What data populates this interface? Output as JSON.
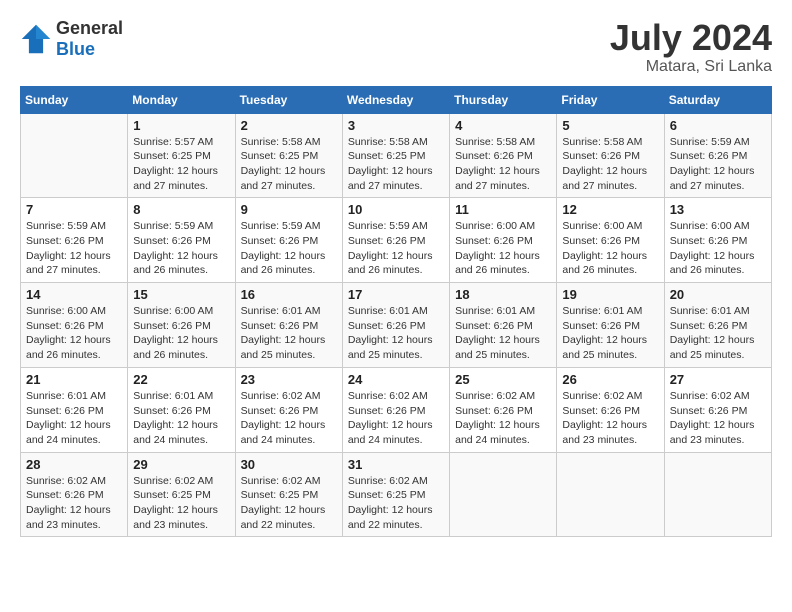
{
  "logo": {
    "general": "General",
    "blue": "Blue"
  },
  "header": {
    "month": "July 2024",
    "location": "Matara, Sri Lanka"
  },
  "days_of_week": [
    "Sunday",
    "Monday",
    "Tuesday",
    "Wednesday",
    "Thursday",
    "Friday",
    "Saturday"
  ],
  "weeks": [
    [
      {
        "day": "",
        "info": ""
      },
      {
        "day": "1",
        "info": "Sunrise: 5:57 AM\nSunset: 6:25 PM\nDaylight: 12 hours\nand 27 minutes."
      },
      {
        "day": "2",
        "info": "Sunrise: 5:58 AM\nSunset: 6:25 PM\nDaylight: 12 hours\nand 27 minutes."
      },
      {
        "day": "3",
        "info": "Sunrise: 5:58 AM\nSunset: 6:25 PM\nDaylight: 12 hours\nand 27 minutes."
      },
      {
        "day": "4",
        "info": "Sunrise: 5:58 AM\nSunset: 6:26 PM\nDaylight: 12 hours\nand 27 minutes."
      },
      {
        "day": "5",
        "info": "Sunrise: 5:58 AM\nSunset: 6:26 PM\nDaylight: 12 hours\nand 27 minutes."
      },
      {
        "day": "6",
        "info": "Sunrise: 5:59 AM\nSunset: 6:26 PM\nDaylight: 12 hours\nand 27 minutes."
      }
    ],
    [
      {
        "day": "7",
        "info": "Sunrise: 5:59 AM\nSunset: 6:26 PM\nDaylight: 12 hours\nand 27 minutes."
      },
      {
        "day": "8",
        "info": "Sunrise: 5:59 AM\nSunset: 6:26 PM\nDaylight: 12 hours\nand 26 minutes."
      },
      {
        "day": "9",
        "info": "Sunrise: 5:59 AM\nSunset: 6:26 PM\nDaylight: 12 hours\nand 26 minutes."
      },
      {
        "day": "10",
        "info": "Sunrise: 5:59 AM\nSunset: 6:26 PM\nDaylight: 12 hours\nand 26 minutes."
      },
      {
        "day": "11",
        "info": "Sunrise: 6:00 AM\nSunset: 6:26 PM\nDaylight: 12 hours\nand 26 minutes."
      },
      {
        "day": "12",
        "info": "Sunrise: 6:00 AM\nSunset: 6:26 PM\nDaylight: 12 hours\nand 26 minutes."
      },
      {
        "day": "13",
        "info": "Sunrise: 6:00 AM\nSunset: 6:26 PM\nDaylight: 12 hours\nand 26 minutes."
      }
    ],
    [
      {
        "day": "14",
        "info": "Sunrise: 6:00 AM\nSunset: 6:26 PM\nDaylight: 12 hours\nand 26 minutes."
      },
      {
        "day": "15",
        "info": "Sunrise: 6:00 AM\nSunset: 6:26 PM\nDaylight: 12 hours\nand 26 minutes."
      },
      {
        "day": "16",
        "info": "Sunrise: 6:01 AM\nSunset: 6:26 PM\nDaylight: 12 hours\nand 25 minutes."
      },
      {
        "day": "17",
        "info": "Sunrise: 6:01 AM\nSunset: 6:26 PM\nDaylight: 12 hours\nand 25 minutes."
      },
      {
        "day": "18",
        "info": "Sunrise: 6:01 AM\nSunset: 6:26 PM\nDaylight: 12 hours\nand 25 minutes."
      },
      {
        "day": "19",
        "info": "Sunrise: 6:01 AM\nSunset: 6:26 PM\nDaylight: 12 hours\nand 25 minutes."
      },
      {
        "day": "20",
        "info": "Sunrise: 6:01 AM\nSunset: 6:26 PM\nDaylight: 12 hours\nand 25 minutes."
      }
    ],
    [
      {
        "day": "21",
        "info": "Sunrise: 6:01 AM\nSunset: 6:26 PM\nDaylight: 12 hours\nand 24 minutes."
      },
      {
        "day": "22",
        "info": "Sunrise: 6:01 AM\nSunset: 6:26 PM\nDaylight: 12 hours\nand 24 minutes."
      },
      {
        "day": "23",
        "info": "Sunrise: 6:02 AM\nSunset: 6:26 PM\nDaylight: 12 hours\nand 24 minutes."
      },
      {
        "day": "24",
        "info": "Sunrise: 6:02 AM\nSunset: 6:26 PM\nDaylight: 12 hours\nand 24 minutes."
      },
      {
        "day": "25",
        "info": "Sunrise: 6:02 AM\nSunset: 6:26 PM\nDaylight: 12 hours\nand 24 minutes."
      },
      {
        "day": "26",
        "info": "Sunrise: 6:02 AM\nSunset: 6:26 PM\nDaylight: 12 hours\nand 23 minutes."
      },
      {
        "day": "27",
        "info": "Sunrise: 6:02 AM\nSunset: 6:26 PM\nDaylight: 12 hours\nand 23 minutes."
      }
    ],
    [
      {
        "day": "28",
        "info": "Sunrise: 6:02 AM\nSunset: 6:26 PM\nDaylight: 12 hours\nand 23 minutes."
      },
      {
        "day": "29",
        "info": "Sunrise: 6:02 AM\nSunset: 6:25 PM\nDaylight: 12 hours\nand 23 minutes."
      },
      {
        "day": "30",
        "info": "Sunrise: 6:02 AM\nSunset: 6:25 PM\nDaylight: 12 hours\nand 22 minutes."
      },
      {
        "day": "31",
        "info": "Sunrise: 6:02 AM\nSunset: 6:25 PM\nDaylight: 12 hours\nand 22 minutes."
      },
      {
        "day": "",
        "info": ""
      },
      {
        "day": "",
        "info": ""
      },
      {
        "day": "",
        "info": ""
      }
    ]
  ]
}
